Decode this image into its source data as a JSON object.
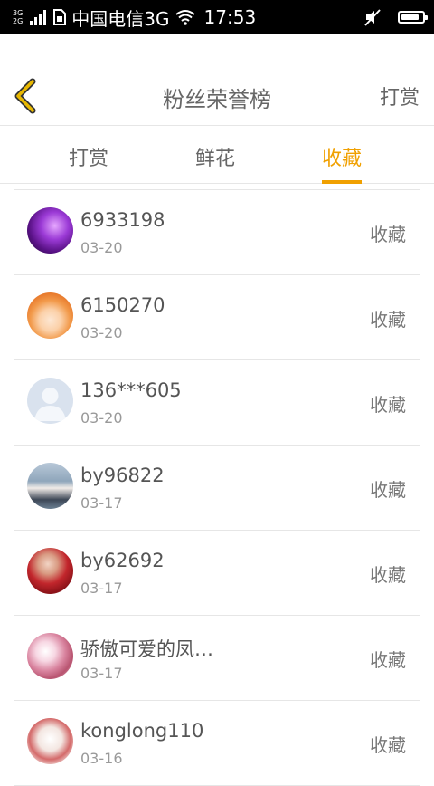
{
  "status_bar": {
    "network_top": "3G",
    "network_bottom": "2G",
    "carrier": "中国电信3G",
    "time": "17:53",
    "icons": [
      "signal-bars-icon",
      "sim-card-icon",
      "wifi-icon",
      "mute-icon",
      "battery-icon"
    ],
    "battery_level": 0.85
  },
  "header": {
    "title": "粉丝荣誉榜",
    "action_label": "打赏",
    "back_icon": "chevron-left-icon",
    "back_color": "#e8b800"
  },
  "tabs": [
    {
      "label": "打赏",
      "active": false
    },
    {
      "label": "鲜花",
      "active": false
    },
    {
      "label": "收藏",
      "active": true
    }
  ],
  "accent_color": "#f0a000",
  "fans": [
    {
      "name": "6933198",
      "date": "03-20",
      "action": "收藏",
      "avatar": "purple-tree-photo"
    },
    {
      "name": "6150270",
      "date": "03-20",
      "action": "收藏",
      "avatar": "anime-girl-orange"
    },
    {
      "name": "136***605",
      "date": "03-20",
      "action": "收藏",
      "avatar": "default-user-placeholder"
    },
    {
      "name": "by96822",
      "date": "03-17",
      "action": "收藏",
      "avatar": "girl-portrait"
    },
    {
      "name": "by62692",
      "date": "03-17",
      "action": "收藏",
      "avatar": "woman-red-dress"
    },
    {
      "name": "骄傲可爱的凤…",
      "date": "03-17",
      "action": "收藏",
      "avatar": "pink-floral-art"
    },
    {
      "name": "konglong110",
      "date": "03-16",
      "action": "收藏",
      "avatar": "anime-girl-sketch"
    }
  ]
}
